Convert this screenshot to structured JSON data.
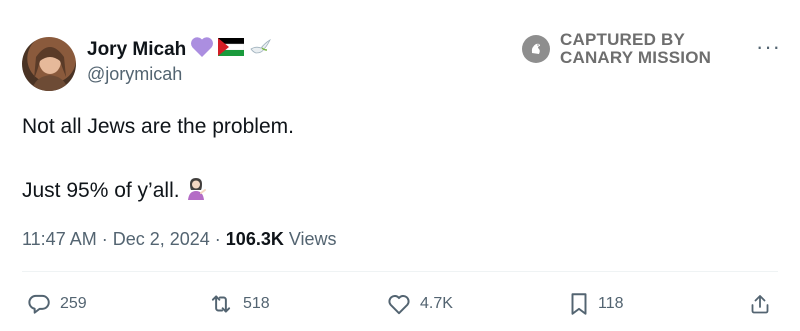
{
  "user": {
    "display_name": "Jory Micah",
    "handle": "@jorymicah"
  },
  "watermark": {
    "line1": "CAPTURED BY",
    "line2": "CANARY MISSION"
  },
  "more_label": "···",
  "tweet": {
    "line1": "Not all Jews are the problem.",
    "line2": "Just 95% of y’all."
  },
  "meta": {
    "time": "11:47 AM",
    "sep1": " · ",
    "date": "Dec 2, 2024",
    "sep2": " · ",
    "views_count": "106.3K",
    "views_label": " Views"
  },
  "actions": {
    "replies": "259",
    "reposts": "518",
    "likes": "4.7K",
    "bookmarks": "118"
  },
  "icons": {
    "heart_emoji": "purple-heart-icon",
    "flag_emoji": "palestine-flag-icon",
    "dove_emoji": "dove-icon",
    "shrug_emoji": "woman-tipping-hand-icon",
    "reply": "reply-icon",
    "repost": "repost-icon",
    "like": "like-icon",
    "bookmark": "bookmark-icon",
    "share": "share-icon"
  },
  "colors": {
    "text": "#0f1419",
    "muted": "#536471",
    "heart": "#ab8ee0"
  }
}
